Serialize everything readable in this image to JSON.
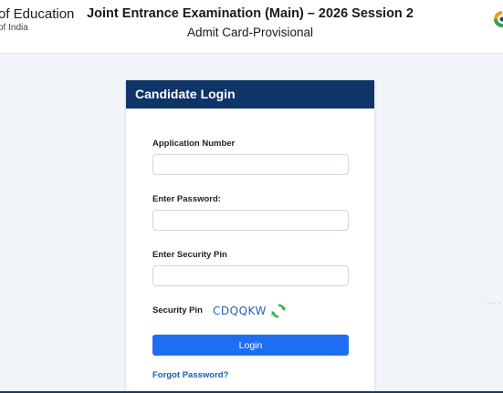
{
  "header": {
    "ministry_line1": "of Education",
    "ministry_line2": "of India",
    "title": "Joint Entrance Examination (Main) – 2026 Session 2",
    "subtitle": "Admit Card-Provisional",
    "logo_icon": "nta-logo-icon"
  },
  "login": {
    "heading": "Candidate Login",
    "application_label": "Application Number",
    "application_value": "",
    "password_label": "Enter Password:",
    "password_value": "",
    "security_label": "Enter Security Pin",
    "security_value": "",
    "captcha_label": "Security Pin",
    "captcha_text": "CDQQKW",
    "refresh_icon": "refresh-icon",
    "login_button": "Login",
    "forgot_link": "Forgot Password?"
  },
  "colors": {
    "card_header": "#0e3468",
    "button": "#1d6ef2",
    "link": "#1a5fb8",
    "captcha": "#2860b8",
    "refresh": "#3cb44a"
  }
}
